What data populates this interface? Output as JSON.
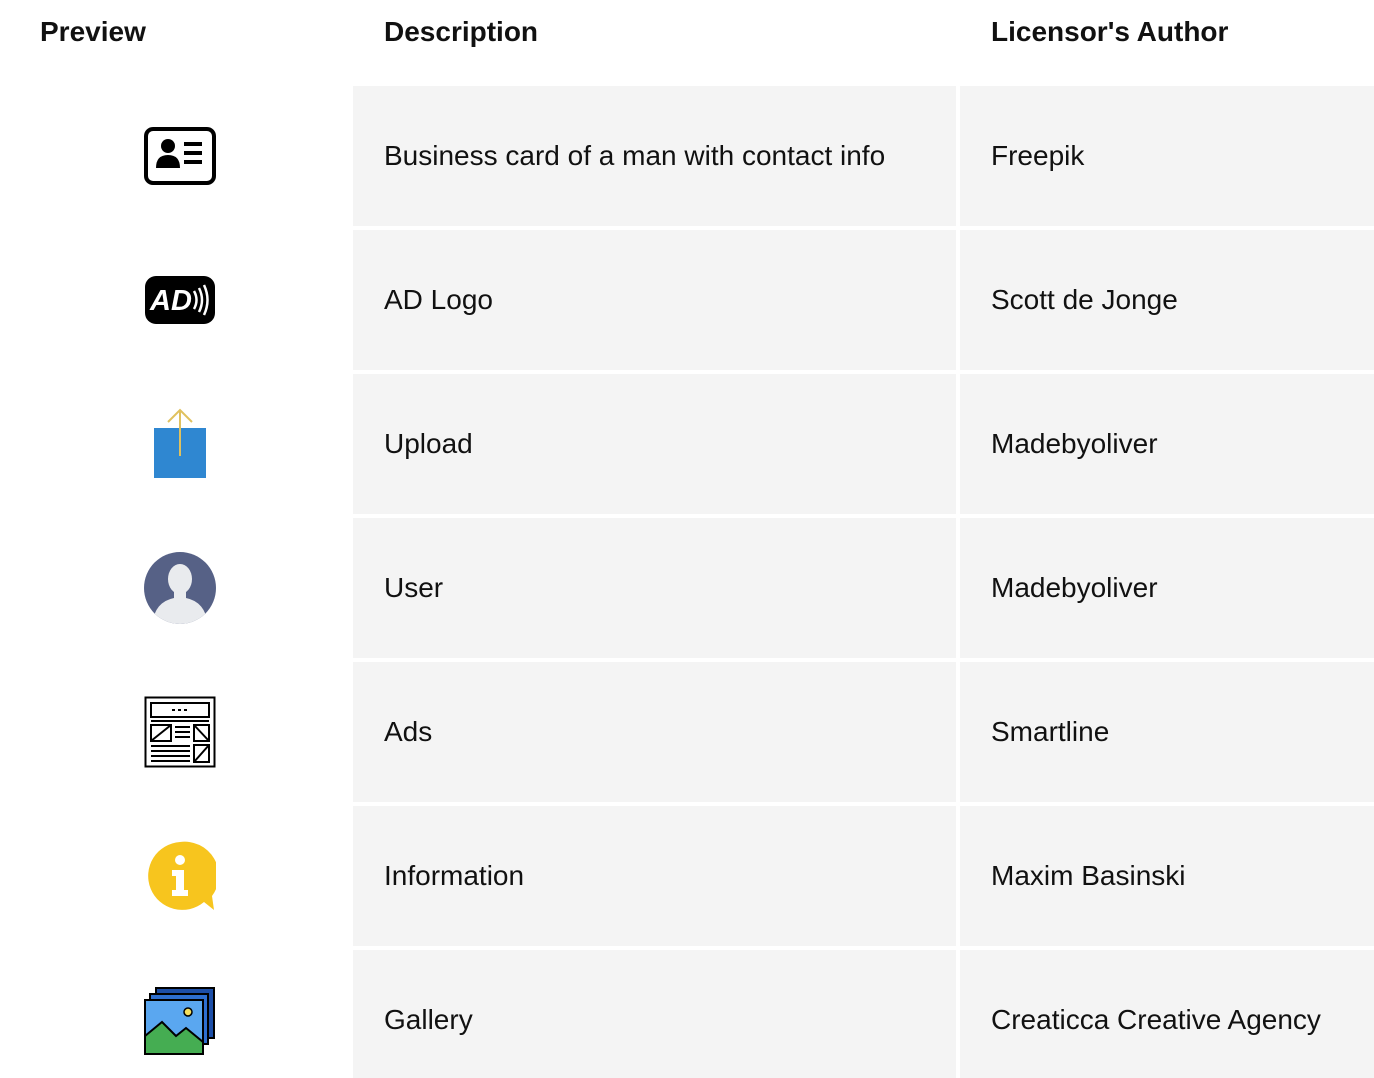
{
  "header": {
    "preview": "Preview",
    "description": "Description",
    "author": "Licensor's Author"
  },
  "rows": [
    {
      "icon": "business-card-icon",
      "description": "Business card of a man with contact info",
      "author": "Freepik"
    },
    {
      "icon": "audio-description-icon",
      "description": "AD Logo",
      "author": "Scott de Jonge"
    },
    {
      "icon": "upload-icon",
      "description": "Upload",
      "author": "Madebyoliver"
    },
    {
      "icon": "user-icon",
      "description": "User",
      "author": "Madebyoliver"
    },
    {
      "icon": "ads-icon",
      "description": "Ads",
      "author": "Smartline"
    },
    {
      "icon": "information-icon",
      "description": "Information",
      "author": "Maxim Basinski"
    },
    {
      "icon": "gallery-icon",
      "description": "Gallery",
      "author": "Creaticca Creative Agency"
    }
  ],
  "icon_glyphs": {
    "audio_description": "AD"
  },
  "colors": {
    "row_background": "#f4f4f4",
    "upload_blue": "#2f87d1",
    "upload_arrow": "#e0c15e",
    "user_circle": "#566186",
    "info_yellow": "#f7c51e",
    "gallery_green": "#45ad52"
  }
}
